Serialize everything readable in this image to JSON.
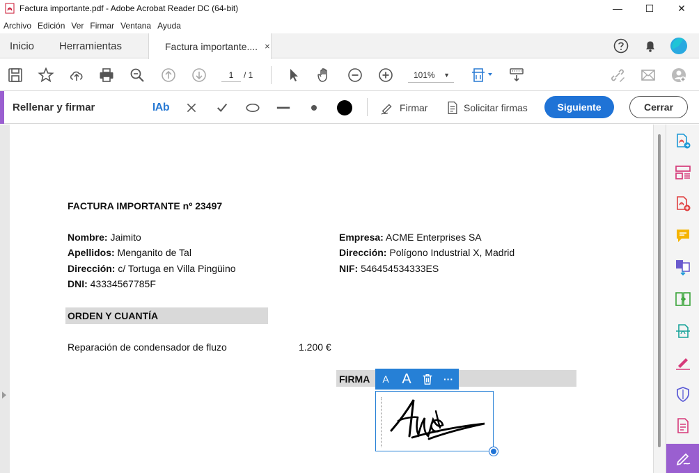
{
  "window": {
    "title": "Factura importante.pdf - Adobe Acrobat Reader DC (64-bit)",
    "minimize": "—",
    "maximize": "☐",
    "close": "✕"
  },
  "menu": [
    "Archivo",
    "Edición",
    "Ver",
    "Firmar",
    "Ventana",
    "Ayuda"
  ],
  "tabs": {
    "home": "Inicio",
    "tools": "Herramientas",
    "document": "Factura importante....",
    "close": "×"
  },
  "toolbar": {
    "page_current": "1",
    "page_total": "/ 1",
    "zoom": "101%",
    "zoom_caret": "▼"
  },
  "fill_sign": {
    "title": "Rellenar y firmar",
    "text_tool": "IAb",
    "sign_label": "Firmar",
    "request_label": "Solicitar firmas",
    "next_button": "Siguiente",
    "close_button": "Cerrar"
  },
  "document": {
    "heading": "FACTURA IMPORTANTE nº 23497",
    "client": [
      {
        "label": "Nombre:",
        "value": " Jaimito"
      },
      {
        "label": "Apellidos:",
        "value": " Menganito de Tal"
      },
      {
        "label": "Dirección:",
        "value": " c/ Tortuga en Villa Pingüino"
      },
      {
        "label": "DNI:",
        "value": " 43334567785F"
      }
    ],
    "company": [
      {
        "label": "Empresa:",
        "value": " ACME Enterprises SA"
      },
      {
        "label": "Dirección:",
        "value": " Polígono Industrial X, Madrid"
      },
      {
        "label": "NIF:",
        "value": " 546454534333ES"
      }
    ],
    "order_section": "ORDEN Y CUANTÍA",
    "order_item": "Reparación de condensador de fluzo",
    "order_amount": "1.200 €",
    "signature_section": "FIRMA"
  },
  "signature_toolbar": {
    "smaller_text": "A",
    "larger_text": "A",
    "more": "···"
  },
  "colors": {
    "accent_purple": "#9a5fd0",
    "primary_blue": "#1f73d6",
    "selection_blue": "#2680d6",
    "section_gray": "#d9d9d9"
  }
}
